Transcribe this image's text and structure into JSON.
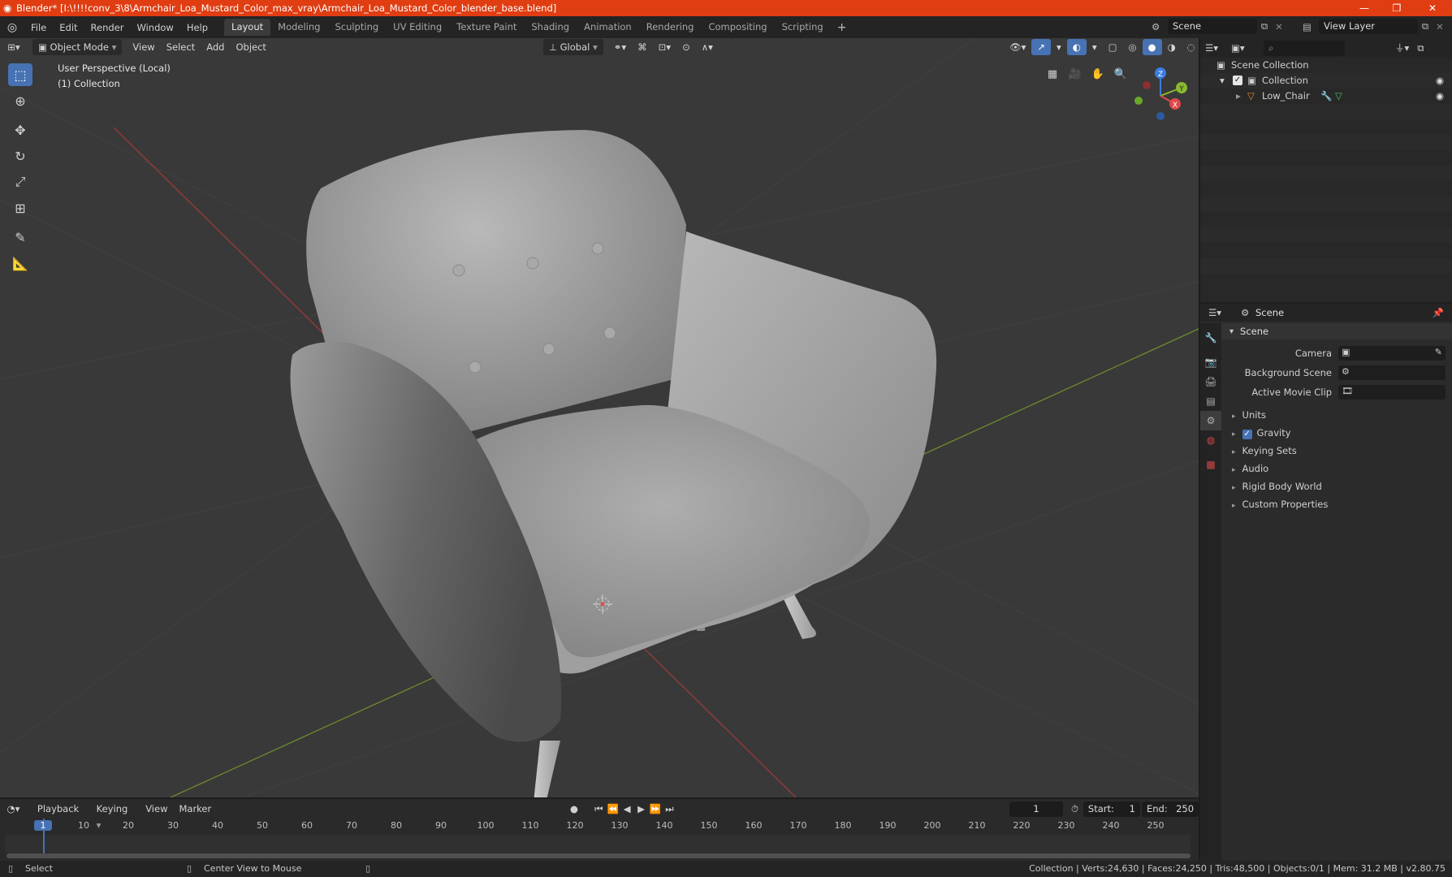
{
  "window": {
    "title": "Blender* [I:\\!!!!conv_3\\8\\Armchair_Loa_Mustard_Color_max_vray\\Armchair_Loa_Mustard_Color_blender_base.blend]",
    "accent_color": "#e03d12"
  },
  "menu": [
    "File",
    "Edit",
    "Render",
    "Window",
    "Help"
  ],
  "workspaces": [
    "Layout",
    "Modeling",
    "Sculpting",
    "UV Editing",
    "Texture Paint",
    "Shading",
    "Animation",
    "Rendering",
    "Compositing",
    "Scripting"
  ],
  "active_workspace": "Layout",
  "scene_name": "Scene",
  "view_layer": "View Layer",
  "viewport": {
    "mode": "Object Mode",
    "menus": [
      "View",
      "Select",
      "Add",
      "Object"
    ],
    "transform_orientation": "Global",
    "overlay_text_1": "User Perspective (Local)",
    "overlay_text_2": "(1) Collection",
    "gizmo_axes": {
      "x": "X",
      "y": "Y",
      "z": "Z"
    },
    "colors": {
      "x_axis": "#9c3a3a",
      "y_axis": "#6c8a2e",
      "accent": "#4772b3"
    }
  },
  "outliner": {
    "root": "Scene Collection",
    "collection": "Collection",
    "object": "Low_Chair"
  },
  "properties": {
    "context": "Scene",
    "panel": "Scene",
    "fields": [
      {
        "label": "Camera"
      },
      {
        "label": "Background Scene"
      },
      {
        "label": "Active Movie Clip"
      }
    ],
    "subpanels": [
      "Units",
      "Gravity",
      "Keying Sets",
      "Audio",
      "Rigid Body World",
      "Custom Properties"
    ]
  },
  "timeline": {
    "menus": [
      "Playback",
      "Keying",
      "View",
      "Marker"
    ],
    "current_frame": "1",
    "start_label": "Start:",
    "start": "1",
    "end_label": "End:",
    "end": "250",
    "ticks": [
      "1",
      "10",
      "20",
      "30",
      "40",
      "50",
      "60",
      "70",
      "80",
      "90",
      "100",
      "110",
      "120",
      "130",
      "140",
      "150",
      "160",
      "170",
      "180",
      "190",
      "200",
      "210",
      "220",
      "230",
      "240",
      "250"
    ]
  },
  "statusbar": {
    "left": "Select",
    "middle": "Center View to Mouse",
    "right": "Collection | Verts:24,630 | Faces:24,250 | Tris:48,500 | Objects:0/1 | Mem: 31.2 MB | v2.80.75"
  }
}
